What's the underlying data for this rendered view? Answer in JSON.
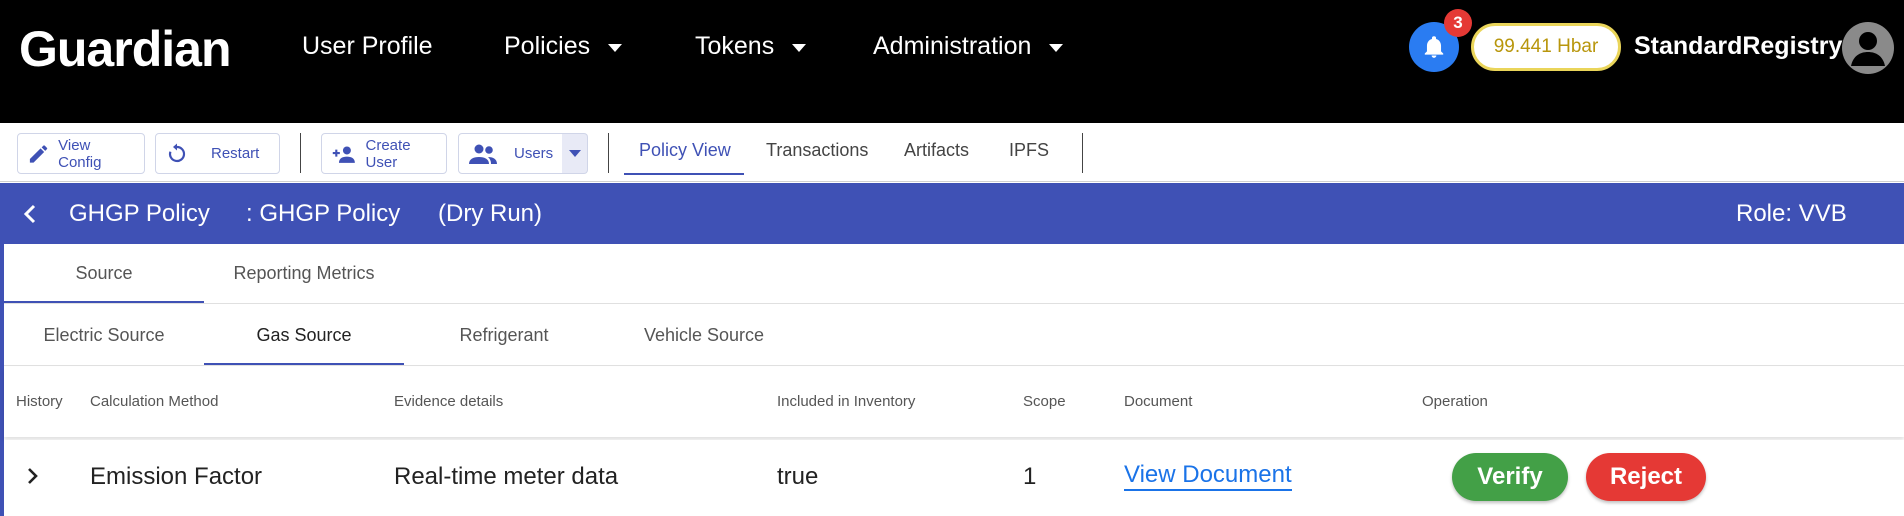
{
  "navbar": {
    "logo": "Guardian",
    "items": [
      {
        "label": "User Profile",
        "has_dropdown": false
      },
      {
        "label": "Policies",
        "has_dropdown": true
      },
      {
        "label": "Tokens",
        "has_dropdown": true
      },
      {
        "label": "Administration",
        "has_dropdown": true
      }
    ],
    "notification_count": "3",
    "balance": "99.441 Hbar",
    "username": "StandardRegistry",
    "icons": {
      "notifications": "bell-icon",
      "avatar": "user-avatar-icon"
    }
  },
  "toolbar": {
    "view_config": "View Config",
    "restart": "Restart",
    "create_user": "Create User",
    "users": "Users",
    "tabs": [
      "Policy View",
      "Transactions",
      "Artifacts",
      "IPFS"
    ],
    "active_tab": "Policy View",
    "icons": {
      "view_config": "pencil-icon",
      "restart": "restart-icon",
      "create_user": "person-add-icon",
      "users": "people-icon"
    }
  },
  "policy_header": {
    "name": "GHGP Policy",
    "subtitle": ": GHGP Policy",
    "mode": "(Dry Run)",
    "role": "Role: VVB"
  },
  "tabs_level1": {
    "items": [
      "Source",
      "Reporting Metrics"
    ],
    "active": "Source"
  },
  "tabs_level2": {
    "items": [
      "Electric Source",
      "Gas Source",
      "Refrigerant",
      "Vehicle Source"
    ],
    "active": "Gas Source"
  },
  "table": {
    "columns": [
      "History",
      "Calculation Method",
      "Evidence details",
      "Included in Inventory",
      "Scope",
      "Document",
      "Operation"
    ],
    "rows": [
      {
        "calculation_method": "Emission Factor",
        "evidence_details": "Real-time meter data",
        "included_in_inventory": "true",
        "scope": "1",
        "document": "View Document",
        "operations": [
          "Verify",
          "Reject"
        ]
      }
    ]
  },
  "colors": {
    "primary": "#3f51b5",
    "verify": "#43a047",
    "reject": "#e53935",
    "link": "#1a73e8",
    "balance_border": "#ead55a"
  }
}
